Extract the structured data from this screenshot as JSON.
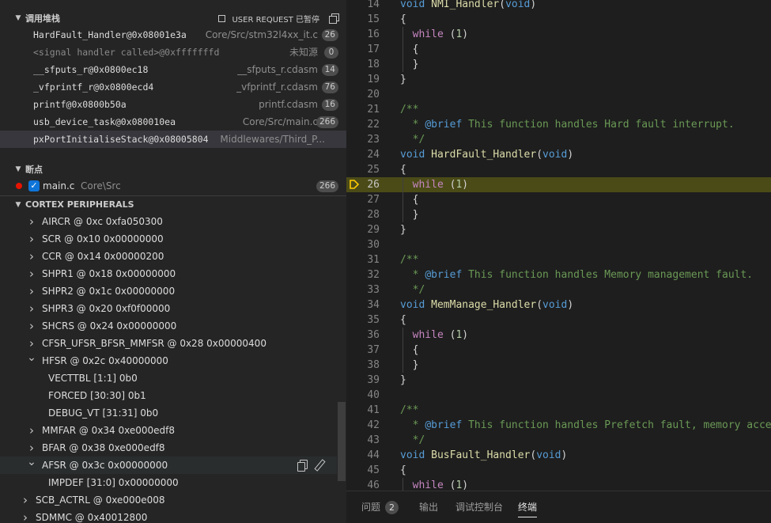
{
  "call_stack": {
    "title": "调用堆栈",
    "status": "USER REQUEST 已暂停",
    "frames": [
      {
        "fn": "HardFault_Handler@0x08001e3a",
        "src": "Core/Src/stm32l4xx_it.c",
        "line": "26"
      },
      {
        "fn": "<signal handler called>@0xfffffffd",
        "src": "未知源",
        "line": "0"
      },
      {
        "fn": "__sfputs_r@0x0800ec18",
        "src": "__sfputs_r.cdasm",
        "line": "14"
      },
      {
        "fn": "_vfprintf_r@0x0800ecd4",
        "src": "_vfprintf_r.cdasm",
        "line": "76"
      },
      {
        "fn": "printf@0x0800b50a",
        "src": "printf.cdasm",
        "line": "16"
      },
      {
        "fn": "usb_device_task@0x080010ea",
        "src": "Core/Src/main.c",
        "line": "266"
      },
      {
        "fn": "pxPortInitialiseStack@0x08005804",
        "src": "Middlewares/Third_P...",
        "line": ""
      }
    ]
  },
  "breakpoints": {
    "title": "断点",
    "items": [
      {
        "file": "main.c",
        "path": "Core\\Src",
        "line": "266",
        "checked": true
      }
    ]
  },
  "peripherals": {
    "title": "CORTEX PERIPHERALS",
    "rows": [
      {
        "label": "AIRCR @ 0xc 0xfa050300",
        "expanded": false,
        "level": 1
      },
      {
        "label": "SCR @ 0x10 0x00000000",
        "expanded": false,
        "level": 1
      },
      {
        "label": "CCR @ 0x14 0x00000200",
        "expanded": false,
        "level": 1
      },
      {
        "label": "SHPR1 @ 0x18 0x00000000",
        "expanded": false,
        "level": 1
      },
      {
        "label": "SHPR2 @ 0x1c 0x00000000",
        "expanded": false,
        "level": 1
      },
      {
        "label": "SHPR3 @ 0x20 0xf0f00000",
        "expanded": false,
        "level": 1
      },
      {
        "label": "SHCRS @ 0x24 0x00000000",
        "expanded": false,
        "level": 1
      },
      {
        "label": "CFSR_UFSR_BFSR_MMFSR @ 0x28 0x00000400",
        "expanded": false,
        "level": 1
      },
      {
        "label": "HFSR @ 0x2c 0x40000000",
        "expanded": true,
        "level": 1
      },
      {
        "label": "VECTTBL [1:1] 0b0",
        "level": 2
      },
      {
        "label": "FORCED [30:30] 0b1",
        "level": 2
      },
      {
        "label": "DEBUG_VT [31:31] 0b0",
        "level": 2
      },
      {
        "label": "MMFAR @ 0x34 0xe000edf8",
        "expanded": false,
        "level": 1
      },
      {
        "label": "BFAR @ 0x38 0xe000edf8",
        "expanded": false,
        "level": 1
      },
      {
        "label": "AFSR @ 0x3c 0x00000000",
        "expanded": true,
        "level": 1
      },
      {
        "label": "IMPDEF [31:0] 0x00000000",
        "level": 2
      },
      {
        "label": "SCB_ACTRL @ 0xe000e008",
        "expanded": false,
        "level": 0
      },
      {
        "label": "SDMMC @ 0x40012800",
        "expanded": false,
        "level": 0
      }
    ]
  },
  "editor": {
    "current_line": 26,
    "lines": [
      {
        "n": "14",
        "code": [
          [
            "k",
            "void"
          ],
          [
            "t",
            " "
          ],
          [
            "f",
            "NMI_Handler"
          ],
          [
            "t",
            "("
          ],
          [
            "k",
            "void"
          ],
          [
            "t",
            ")"
          ]
        ]
      },
      {
        "n": "15",
        "code": [
          [
            "t",
            "{"
          ]
        ]
      },
      {
        "n": "16",
        "code": [
          [
            "t",
            "  "
          ],
          [
            "c",
            "while"
          ],
          [
            "t",
            " ("
          ],
          [
            "n",
            "1"
          ],
          [
            "t",
            ")"
          ]
        ]
      },
      {
        "n": "17",
        "code": [
          [
            "t",
            "  {"
          ]
        ]
      },
      {
        "n": "18",
        "code": [
          [
            "t",
            "  }"
          ]
        ]
      },
      {
        "n": "19",
        "code": [
          [
            "t",
            "}"
          ]
        ]
      },
      {
        "n": "20",
        "code": []
      },
      {
        "n": "21",
        "code": [
          [
            "cm",
            "/**"
          ]
        ]
      },
      {
        "n": "22",
        "code": [
          [
            "cm",
            "  * "
          ],
          [
            "tag",
            "@brief"
          ],
          [
            "cm",
            " This function handles Hard fault interrupt."
          ]
        ]
      },
      {
        "n": "23",
        "code": [
          [
            "cm",
            "  */"
          ]
        ]
      },
      {
        "n": "24",
        "code": [
          [
            "k",
            "void"
          ],
          [
            "t",
            " "
          ],
          [
            "f",
            "HardFault_Handler"
          ],
          [
            "t",
            "("
          ],
          [
            "k",
            "void"
          ],
          [
            "t",
            ")"
          ]
        ]
      },
      {
        "n": "25",
        "code": [
          [
            "t",
            "{"
          ]
        ]
      },
      {
        "n": "26",
        "code": [
          [
            "t",
            "  "
          ],
          [
            "c",
            "while"
          ],
          [
            "t",
            " ("
          ],
          [
            "n",
            "1"
          ],
          [
            "t",
            ")"
          ]
        ]
      },
      {
        "n": "27",
        "code": [
          [
            "t",
            "  {"
          ]
        ]
      },
      {
        "n": "28",
        "code": [
          [
            "t",
            "  }"
          ]
        ]
      },
      {
        "n": "29",
        "code": [
          [
            "t",
            "}"
          ]
        ]
      },
      {
        "n": "30",
        "code": []
      },
      {
        "n": "31",
        "code": [
          [
            "cm",
            "/**"
          ]
        ]
      },
      {
        "n": "32",
        "code": [
          [
            "cm",
            "  * "
          ],
          [
            "tag",
            "@brief"
          ],
          [
            "cm",
            " This function handles Memory management fault."
          ]
        ]
      },
      {
        "n": "33",
        "code": [
          [
            "cm",
            "  */"
          ]
        ]
      },
      {
        "n": "34",
        "code": [
          [
            "k",
            "void"
          ],
          [
            "t",
            " "
          ],
          [
            "f",
            "MemManage_Handler"
          ],
          [
            "t",
            "("
          ],
          [
            "k",
            "void"
          ],
          [
            "t",
            ")"
          ]
        ]
      },
      {
        "n": "35",
        "code": [
          [
            "t",
            "{"
          ]
        ]
      },
      {
        "n": "36",
        "code": [
          [
            "t",
            "  "
          ],
          [
            "c",
            "while"
          ],
          [
            "t",
            " ("
          ],
          [
            "n",
            "1"
          ],
          [
            "t",
            ")"
          ]
        ]
      },
      {
        "n": "37",
        "code": [
          [
            "t",
            "  {"
          ]
        ]
      },
      {
        "n": "38",
        "code": [
          [
            "t",
            "  }"
          ]
        ]
      },
      {
        "n": "39",
        "code": [
          [
            "t",
            "}"
          ]
        ]
      },
      {
        "n": "40",
        "code": []
      },
      {
        "n": "41",
        "code": [
          [
            "cm",
            "/**"
          ]
        ]
      },
      {
        "n": "42",
        "code": [
          [
            "cm",
            "  * "
          ],
          [
            "tag",
            "@brief"
          ],
          [
            "cm",
            " This function handles Prefetch fault, memory access"
          ]
        ]
      },
      {
        "n": "43",
        "code": [
          [
            "cm",
            "  */"
          ]
        ]
      },
      {
        "n": "44",
        "code": [
          [
            "k",
            "void"
          ],
          [
            "t",
            " "
          ],
          [
            "f",
            "BusFault_Handler"
          ],
          [
            "t",
            "("
          ],
          [
            "k",
            "void"
          ],
          [
            "t",
            ")"
          ]
        ]
      },
      {
        "n": "45",
        "code": [
          [
            "t",
            "{"
          ]
        ]
      },
      {
        "n": "46",
        "code": [
          [
            "t",
            "  "
          ],
          [
            "c",
            "while"
          ],
          [
            "t",
            " ("
          ],
          [
            "n",
            "1"
          ],
          [
            "t",
            ")"
          ]
        ]
      }
    ]
  },
  "bottom_tabs": {
    "problems": "问题",
    "problems_count": "2",
    "output": "输出",
    "debug_console": "调试控制台",
    "terminal": "终端"
  },
  "icons": {
    "chevron_down": "chevron-down-icon",
    "chevron_right": "chevron-right-icon",
    "breakpoint": "breakpoint-dot-icon",
    "debug_arrow": "debug-current-line-icon"
  },
  "colors": {
    "current_line_bg": "#4b4b18",
    "breakpoint": "#e51400",
    "debug_arrow": "#ffcc00"
  }
}
